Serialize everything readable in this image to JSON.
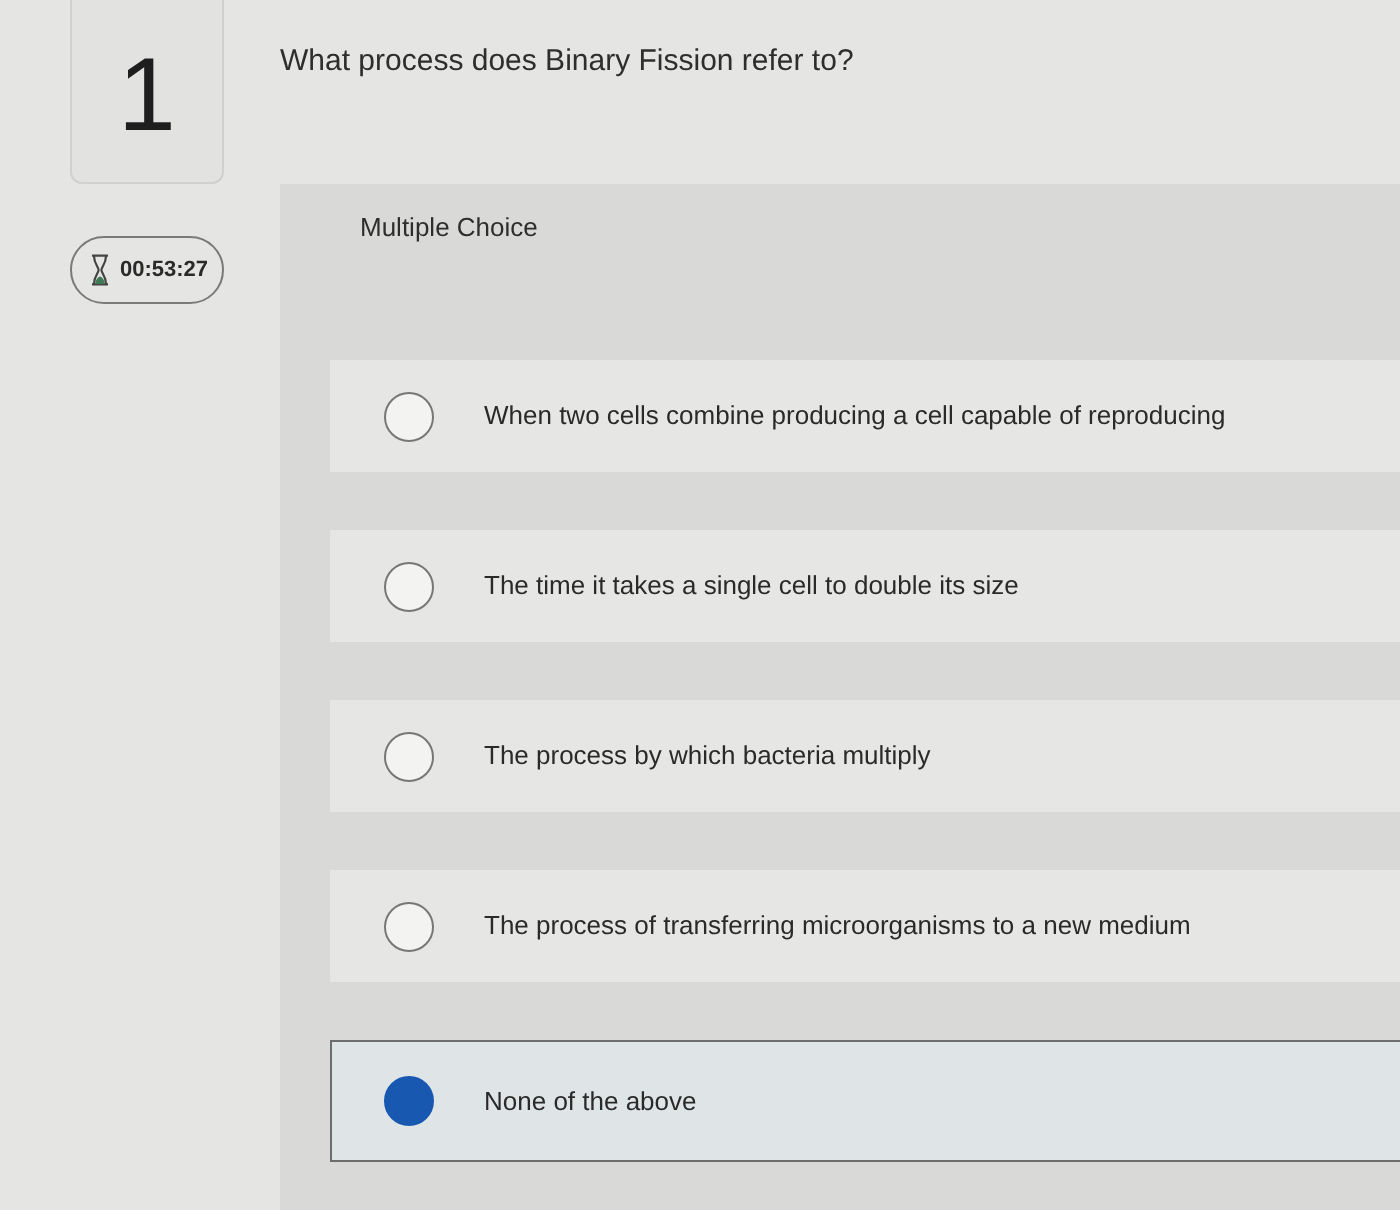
{
  "question": {
    "number": "1",
    "text": "What process does Binary Fission refer to?"
  },
  "timer": {
    "time": "00:53:27"
  },
  "question_type": "Multiple Choice",
  "options": [
    {
      "text": "When two cells combine producing a cell capable of reproducing",
      "selected": false
    },
    {
      "text": "The time it takes a single cell to double its size",
      "selected": false
    },
    {
      "text": "The process by which bacteria multiply",
      "selected": false
    },
    {
      "text": "The process of transferring microorganisms to a new medium",
      "selected": false
    },
    {
      "text": "None of the above",
      "selected": true
    }
  ]
}
